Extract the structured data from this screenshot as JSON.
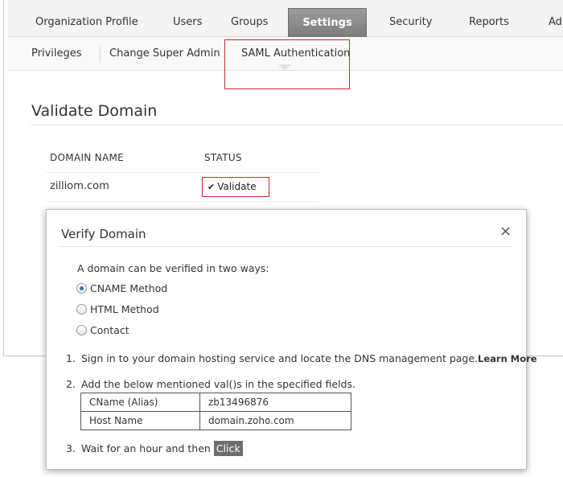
{
  "top_nav": {
    "items": [
      {
        "label": "Organization Profile"
      },
      {
        "label": "Users"
      },
      {
        "label": "Groups"
      },
      {
        "label": "Settings",
        "active": true
      },
      {
        "label": "Security"
      },
      {
        "label": "Reports"
      },
      {
        "label": "Ad"
      }
    ]
  },
  "sub_nav": {
    "items": [
      {
        "label": "Privileges"
      },
      {
        "label": "Change Super Admin"
      },
      {
        "label": "SAML Authentication",
        "active": true
      }
    ]
  },
  "page": {
    "title": "Validate Domain",
    "table": {
      "columns": [
        "DOMAIN NAME",
        "STATUS"
      ],
      "rows": [
        {
          "domain": "zilliom.com",
          "status": "Validate"
        }
      ]
    }
  },
  "modal": {
    "title": "Verify Domain",
    "close_glyph": "×",
    "intro": "A domain can be verified in two ways:",
    "methods": [
      {
        "label": "CNAME Method",
        "checked": true
      },
      {
        "label": "HTML Method",
        "checked": false
      },
      {
        "label": "Contact",
        "checked": false
      }
    ],
    "steps": [
      {
        "num": "1.",
        "text": "Sign in to your domain hosting service and locate the DNS management page.",
        "link": "Learn More"
      },
      {
        "num": "2.",
        "text": "Add the below mentioned val()s in the specified fields."
      },
      {
        "num": "3.",
        "text": "Wait for an hour and then ",
        "button": "Click"
      }
    ],
    "fields": [
      {
        "key": "CName (Alias)",
        "value": "zb13496876"
      },
      {
        "key": "Host Name",
        "value": "domain.zoho.com"
      }
    ]
  },
  "colors": {
    "highlight": "#c8282e",
    "active_tab": "#8a8a8a",
    "radio_dot": "#3a6fb5"
  }
}
